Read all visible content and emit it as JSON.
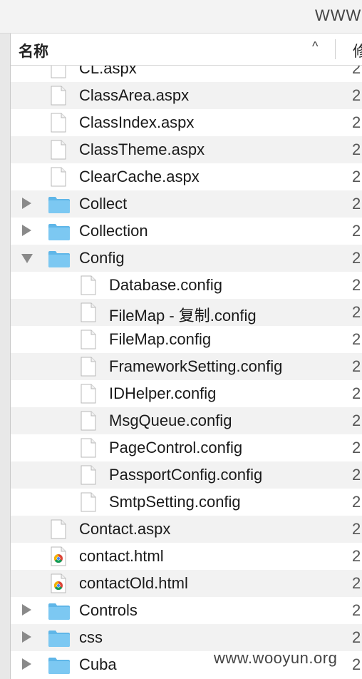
{
  "window": {
    "url_fragment": "WWW"
  },
  "columns": {
    "name": "名称",
    "sort_indicator": "^",
    "modified": "修"
  },
  "rows": [
    {
      "label": "CL.aspx",
      "kind": "file",
      "date": "2"
    },
    {
      "label": "ClassArea.aspx",
      "kind": "file",
      "date": "2"
    },
    {
      "label": "ClassIndex.aspx",
      "kind": "file",
      "date": "2"
    },
    {
      "label": "ClassTheme.aspx",
      "kind": "file",
      "date": "2"
    },
    {
      "label": "ClearCache.aspx",
      "kind": "file",
      "date": "2"
    },
    {
      "label": "Collect",
      "kind": "folder",
      "expanded": false,
      "date": "2"
    },
    {
      "label": "Collection",
      "kind": "folder",
      "expanded": false,
      "date": "2"
    },
    {
      "label": "Config",
      "kind": "folder",
      "expanded": true,
      "date": "2"
    },
    {
      "label": "Database.config",
      "kind": "file",
      "date": "2"
    },
    {
      "label": "FileMap - 复制.config",
      "kind": "file",
      "date": "2"
    },
    {
      "label": "FileMap.config",
      "kind": "file",
      "date": "2"
    },
    {
      "label": "FrameworkSetting.config",
      "kind": "file",
      "date": "2"
    },
    {
      "label": "IDHelper.config",
      "kind": "file",
      "date": "2"
    },
    {
      "label": "MsgQueue.config",
      "kind": "file",
      "date": "2"
    },
    {
      "label": "PageControl.config",
      "kind": "file",
      "date": "2"
    },
    {
      "label": "PassportConfig.config",
      "kind": "file",
      "date": "2"
    },
    {
      "label": "SmtpSetting.config",
      "kind": "file",
      "date": "2"
    },
    {
      "label": "Contact.aspx",
      "kind": "file",
      "date": "2"
    },
    {
      "label": "contact.html",
      "kind": "chrome-file",
      "date": "2"
    },
    {
      "label": "contactOld.html",
      "kind": "chrome-file",
      "date": "2"
    },
    {
      "label": "Controls",
      "kind": "folder",
      "expanded": false,
      "date": "2"
    },
    {
      "label": "css",
      "kind": "folder",
      "expanded": false,
      "date": "2"
    },
    {
      "label": "Cuba",
      "kind": "folder",
      "expanded": false,
      "date": "2"
    }
  ],
  "watermark": "www.wooyun.org",
  "colors": {
    "folder": "#7cc8f2",
    "folder_tab": "#5fb6e8",
    "row_alt": "#f2f2f2",
    "triangle": "#8a8a8a"
  }
}
